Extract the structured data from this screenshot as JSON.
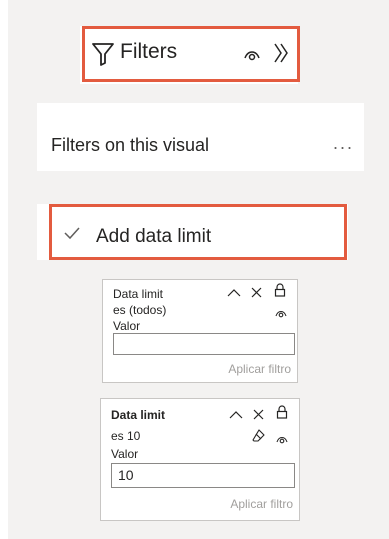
{
  "header": {
    "title": "Filters",
    "icons": [
      "filter-icon",
      "eye-icon",
      "double-chevron-right-icon"
    ]
  },
  "section": {
    "title": "Filters on this visual",
    "more": "..."
  },
  "add_item": {
    "label": "Add data limit",
    "icon": "checkmark-icon"
  },
  "card1": {
    "name": "Data limit",
    "condition": "es (todos)",
    "value_label": "Valor",
    "value": "",
    "apply": "Aplicar filtro"
  },
  "card2": {
    "name": "Data limit",
    "condition": "es 10",
    "value_label": "Valor",
    "value": "10",
    "apply": "Aplicar filtro"
  },
  "colors": {
    "highlight": "#e35b3f",
    "canvas": "#f3f2f1",
    "text": "#252423",
    "muted": "#a19f9d"
  }
}
